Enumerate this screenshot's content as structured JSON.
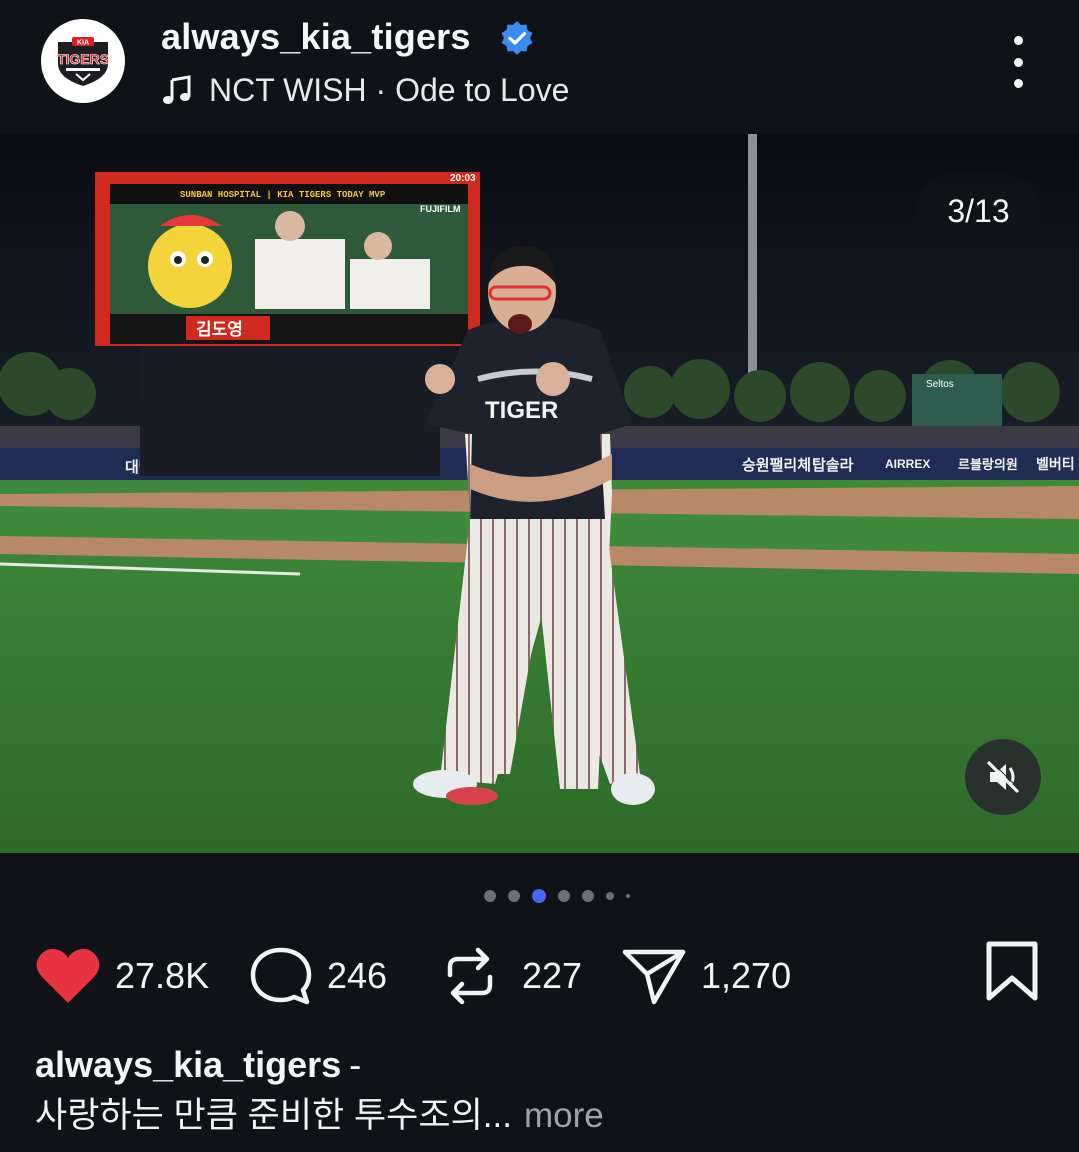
{
  "post": {
    "username": "always_kia_tigers",
    "verified": true,
    "music": {
      "icon": "music-note-icon",
      "track": "NCT WISH · Ode to Love"
    },
    "avatar_logo": {
      "brand": "KIA",
      "team": "TIGERS"
    }
  },
  "media": {
    "counter": "3/13",
    "scoreboard": {
      "banner": "SUNBAN HOSPITAL | KIA TIGERS TODAY MVP",
      "sponsor": "FUJIFILM",
      "player_name": "김도영",
      "time": "20:03"
    },
    "jersey_text": "TIGER",
    "ad_boards": [
      "대방건설",
      "승원팰리체",
      "탑솔라",
      "AIRREX",
      "르블랑의원",
      "벨버티",
      "Seltos"
    ],
    "carousel": {
      "total_dots": 7,
      "active_index": 2
    },
    "mute_icon": "speaker-muted-icon"
  },
  "actions": {
    "likes": "27.8K",
    "comments": "246",
    "reposts": "227",
    "shares": "1,270"
  },
  "caption": {
    "username": "always_kia_tigers",
    "separator": "-",
    "text": "사랑하는 만큼 준비한 투수조의...",
    "more_label": "more"
  },
  "colors": {
    "background": "#0f1217",
    "heart": "#e8323f",
    "verified": "#3a8df0",
    "active_dot": "#4b67f5",
    "more_text": "#9ea3ab"
  }
}
